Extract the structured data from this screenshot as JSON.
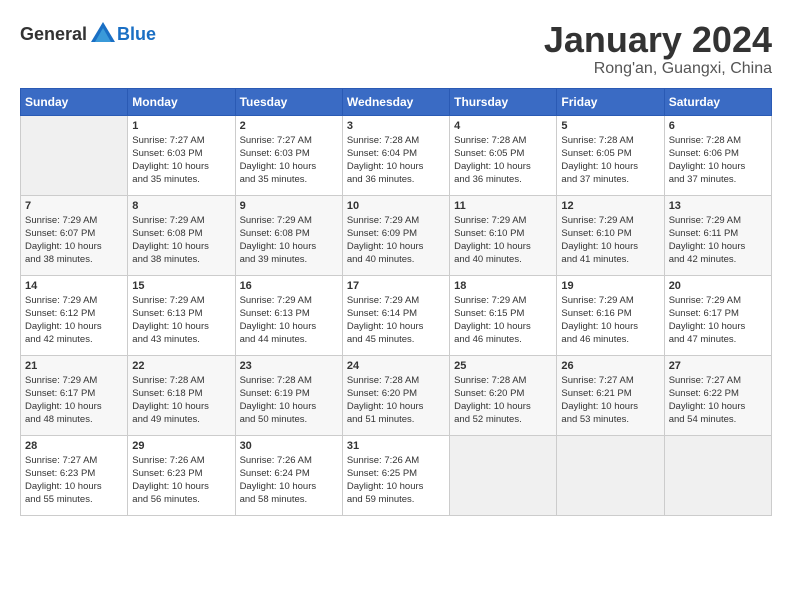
{
  "header": {
    "logo_general": "General",
    "logo_blue": "Blue",
    "month_title": "January 2024",
    "location": "Rong'an, Guangxi, China"
  },
  "calendar": {
    "days_of_week": [
      "Sunday",
      "Monday",
      "Tuesday",
      "Wednesday",
      "Thursday",
      "Friday",
      "Saturday"
    ],
    "weeks": [
      [
        {
          "day": "",
          "info": ""
        },
        {
          "day": "1",
          "info": "Sunrise: 7:27 AM\nSunset: 6:03 PM\nDaylight: 10 hours\nand 35 minutes."
        },
        {
          "day": "2",
          "info": "Sunrise: 7:27 AM\nSunset: 6:03 PM\nDaylight: 10 hours\nand 35 minutes."
        },
        {
          "day": "3",
          "info": "Sunrise: 7:28 AM\nSunset: 6:04 PM\nDaylight: 10 hours\nand 36 minutes."
        },
        {
          "day": "4",
          "info": "Sunrise: 7:28 AM\nSunset: 6:05 PM\nDaylight: 10 hours\nand 36 minutes."
        },
        {
          "day": "5",
          "info": "Sunrise: 7:28 AM\nSunset: 6:05 PM\nDaylight: 10 hours\nand 37 minutes."
        },
        {
          "day": "6",
          "info": "Sunrise: 7:28 AM\nSunset: 6:06 PM\nDaylight: 10 hours\nand 37 minutes."
        }
      ],
      [
        {
          "day": "7",
          "info": "Sunrise: 7:29 AM\nSunset: 6:07 PM\nDaylight: 10 hours\nand 38 minutes."
        },
        {
          "day": "8",
          "info": "Sunrise: 7:29 AM\nSunset: 6:08 PM\nDaylight: 10 hours\nand 38 minutes."
        },
        {
          "day": "9",
          "info": "Sunrise: 7:29 AM\nSunset: 6:08 PM\nDaylight: 10 hours\nand 39 minutes."
        },
        {
          "day": "10",
          "info": "Sunrise: 7:29 AM\nSunset: 6:09 PM\nDaylight: 10 hours\nand 40 minutes."
        },
        {
          "day": "11",
          "info": "Sunrise: 7:29 AM\nSunset: 6:10 PM\nDaylight: 10 hours\nand 40 minutes."
        },
        {
          "day": "12",
          "info": "Sunrise: 7:29 AM\nSunset: 6:10 PM\nDaylight: 10 hours\nand 41 minutes."
        },
        {
          "day": "13",
          "info": "Sunrise: 7:29 AM\nSunset: 6:11 PM\nDaylight: 10 hours\nand 42 minutes."
        }
      ],
      [
        {
          "day": "14",
          "info": "Sunrise: 7:29 AM\nSunset: 6:12 PM\nDaylight: 10 hours\nand 42 minutes."
        },
        {
          "day": "15",
          "info": "Sunrise: 7:29 AM\nSunset: 6:13 PM\nDaylight: 10 hours\nand 43 minutes."
        },
        {
          "day": "16",
          "info": "Sunrise: 7:29 AM\nSunset: 6:13 PM\nDaylight: 10 hours\nand 44 minutes."
        },
        {
          "day": "17",
          "info": "Sunrise: 7:29 AM\nSunset: 6:14 PM\nDaylight: 10 hours\nand 45 minutes."
        },
        {
          "day": "18",
          "info": "Sunrise: 7:29 AM\nSunset: 6:15 PM\nDaylight: 10 hours\nand 46 minutes."
        },
        {
          "day": "19",
          "info": "Sunrise: 7:29 AM\nSunset: 6:16 PM\nDaylight: 10 hours\nand 46 minutes."
        },
        {
          "day": "20",
          "info": "Sunrise: 7:29 AM\nSunset: 6:17 PM\nDaylight: 10 hours\nand 47 minutes."
        }
      ],
      [
        {
          "day": "21",
          "info": "Sunrise: 7:29 AM\nSunset: 6:17 PM\nDaylight: 10 hours\nand 48 minutes."
        },
        {
          "day": "22",
          "info": "Sunrise: 7:28 AM\nSunset: 6:18 PM\nDaylight: 10 hours\nand 49 minutes."
        },
        {
          "day": "23",
          "info": "Sunrise: 7:28 AM\nSunset: 6:19 PM\nDaylight: 10 hours\nand 50 minutes."
        },
        {
          "day": "24",
          "info": "Sunrise: 7:28 AM\nSunset: 6:20 PM\nDaylight: 10 hours\nand 51 minutes."
        },
        {
          "day": "25",
          "info": "Sunrise: 7:28 AM\nSunset: 6:20 PM\nDaylight: 10 hours\nand 52 minutes."
        },
        {
          "day": "26",
          "info": "Sunrise: 7:27 AM\nSunset: 6:21 PM\nDaylight: 10 hours\nand 53 minutes."
        },
        {
          "day": "27",
          "info": "Sunrise: 7:27 AM\nSunset: 6:22 PM\nDaylight: 10 hours\nand 54 minutes."
        }
      ],
      [
        {
          "day": "28",
          "info": "Sunrise: 7:27 AM\nSunset: 6:23 PM\nDaylight: 10 hours\nand 55 minutes."
        },
        {
          "day": "29",
          "info": "Sunrise: 7:26 AM\nSunset: 6:23 PM\nDaylight: 10 hours\nand 56 minutes."
        },
        {
          "day": "30",
          "info": "Sunrise: 7:26 AM\nSunset: 6:24 PM\nDaylight: 10 hours\nand 58 minutes."
        },
        {
          "day": "31",
          "info": "Sunrise: 7:26 AM\nSunset: 6:25 PM\nDaylight: 10 hours\nand 59 minutes."
        },
        {
          "day": "",
          "info": ""
        },
        {
          "day": "",
          "info": ""
        },
        {
          "day": "",
          "info": ""
        }
      ]
    ]
  }
}
